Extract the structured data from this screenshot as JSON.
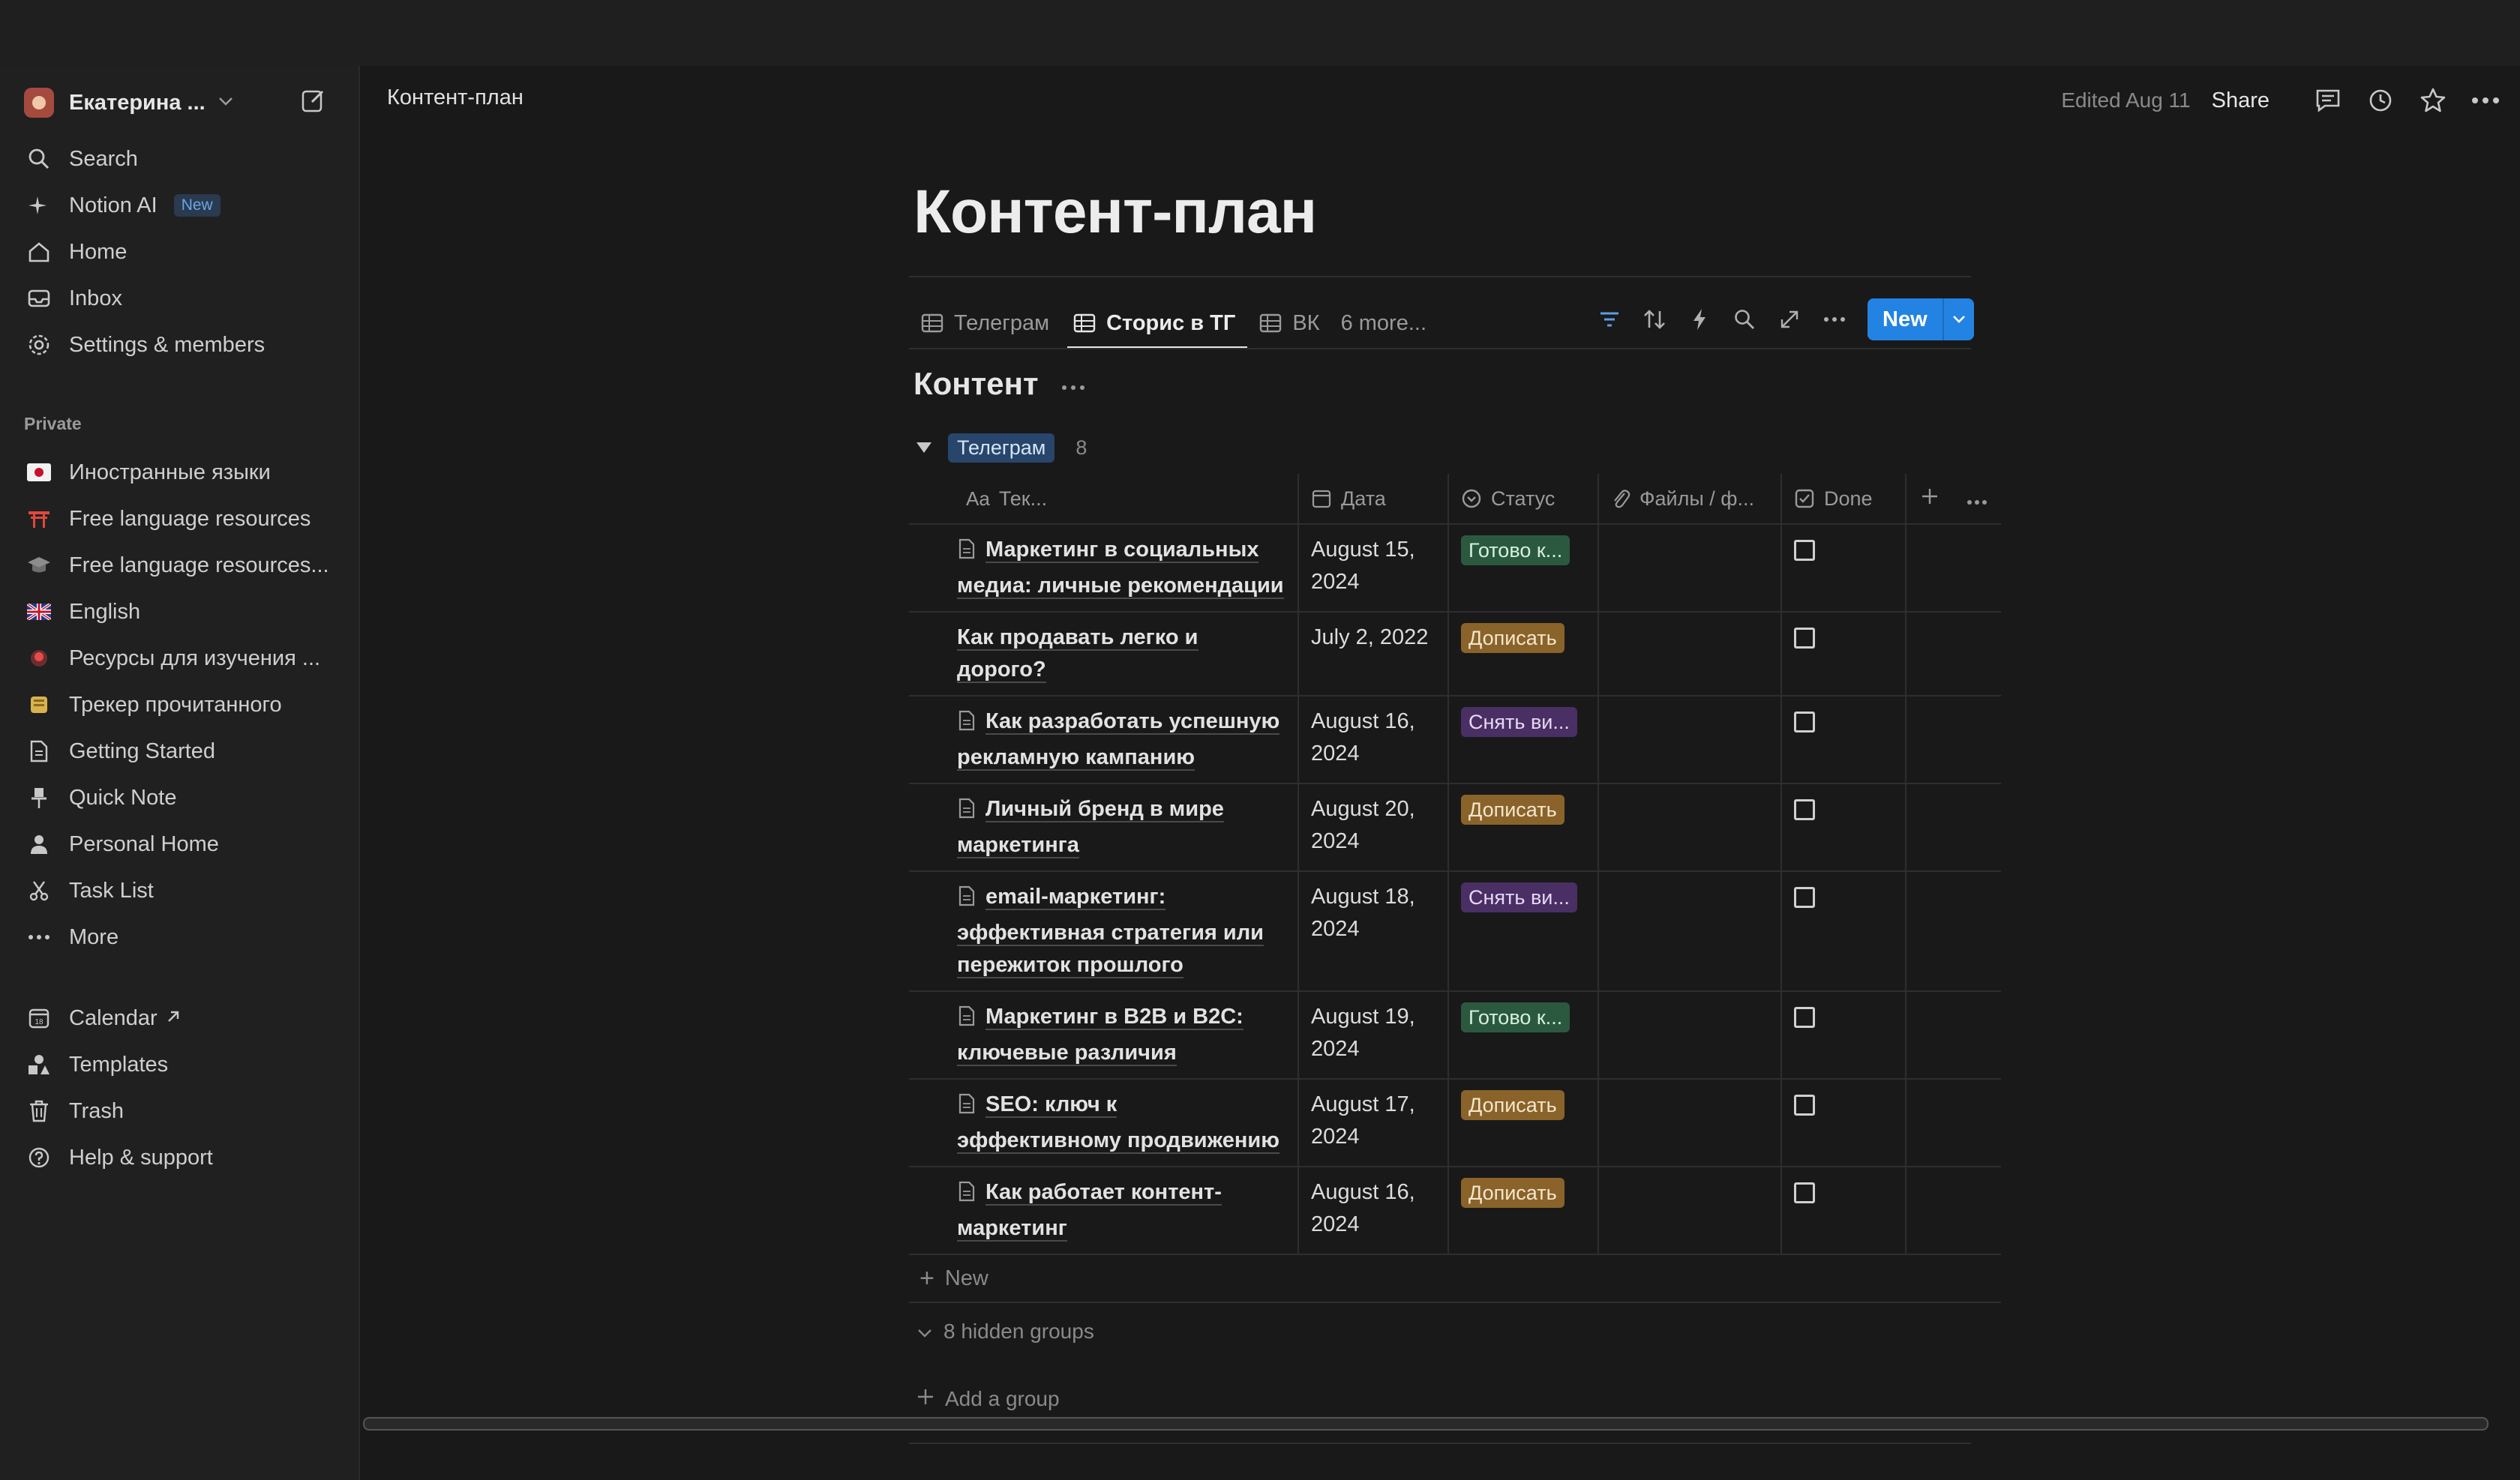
{
  "workspace": {
    "name": "Екатерина ..."
  },
  "sidebar": {
    "top_items": [
      {
        "label": "Search",
        "icon": "search-icon"
      },
      {
        "label": "Notion AI",
        "icon": "sparkle-icon",
        "badge": "New"
      },
      {
        "label": "Home",
        "icon": "home-icon"
      },
      {
        "label": "Inbox",
        "icon": "inbox-icon"
      },
      {
        "label": "Settings & members",
        "icon": "gear-icon"
      }
    ],
    "section_label": "Private",
    "private_items": [
      {
        "label": "Иностранные языки",
        "icon": "japan-flag-icon"
      },
      {
        "label": "Free language resources",
        "icon": "torii-gate-icon"
      },
      {
        "label": "Free language resources...",
        "icon": "graduation-cap-icon"
      },
      {
        "label": "English",
        "icon": "uk-flag-icon"
      },
      {
        "label": "Ресурсы для изучения ...",
        "icon": "red-badge-icon"
      },
      {
        "label": "Трекер прочитанного",
        "icon": "scroll-icon"
      },
      {
        "label": "Getting Started",
        "icon": "page-icon"
      },
      {
        "label": "Quick Note",
        "icon": "pin-icon"
      },
      {
        "label": "Personal Home",
        "icon": "person-icon"
      },
      {
        "label": "Task List",
        "icon": "scissors-icon"
      },
      {
        "label": "More",
        "icon": "more-dots-icon"
      }
    ],
    "bottom_items": [
      {
        "label": "Calendar",
        "icon": "calendar-icon"
      },
      {
        "label": "Templates",
        "icon": "templates-icon"
      },
      {
        "label": "Trash",
        "icon": "trash-icon"
      },
      {
        "label": "Help & support",
        "icon": "help-icon"
      }
    ]
  },
  "header": {
    "breadcrumb": "Контент-план",
    "edited": "Edited Aug 11",
    "share": "Share"
  },
  "page": {
    "title": "Контент-план",
    "views": [
      {
        "label": "Телеграм",
        "active": false
      },
      {
        "label": "Сторис в ТГ",
        "active": true
      },
      {
        "label": "ВК",
        "active": false
      }
    ],
    "views_more": "6 more...",
    "new_button": "New",
    "db_title": "Контент",
    "group": {
      "label": "Телеграм",
      "count": "8"
    },
    "columns": {
      "name": "Тек...",
      "name_prefix": "Aa",
      "date": "Дата",
      "status": "Статус",
      "files": "Файлы / ф...",
      "done": "Done"
    },
    "rows": [
      {
        "name": "Маркетинг в социальных медиа: личные рекомендации",
        "has_doc_icon": true,
        "date": "August 15, 2024",
        "status": "Готово к...",
        "status_color": "#2b593f"
      },
      {
        "name": "Как продавать легко и дорого?",
        "has_doc_icon": false,
        "date": "July 2, 2022",
        "status": "Дописать",
        "status_color": "#89632a"
      },
      {
        "name": "Как разработать успешную рекламную кампанию",
        "has_doc_icon": true,
        "date": "August 16, 2024",
        "status": "Снять ви...",
        "status_color": "#492f64"
      },
      {
        "name": "Личный бренд в мире маркетинга",
        "has_doc_icon": true,
        "date": "August 20, 2024",
        "status": "Дописать",
        "status_color": "#89632a"
      },
      {
        "name": "email-маркетинг: эффективная стратегия или пережиток прошлого",
        "has_doc_icon": true,
        "date": "August 18, 2024",
        "status": "Снять ви...",
        "status_color": "#492f64"
      },
      {
        "name": "Маркетинг в B2B и B2C: ключевые различия",
        "has_doc_icon": true,
        "date": "August 19, 2024",
        "status": "Готово к...",
        "status_color": "#2b593f"
      },
      {
        "name": "SEO: ключ к эффективному продвижению",
        "has_doc_icon": true,
        "date": "August 17, 2024",
        "status": "Дописать",
        "status_color": "#89632a"
      },
      {
        "name": "Как работает контент-маркетинг",
        "has_doc_icon": true,
        "date": "August 16, 2024",
        "status": "Дописать",
        "status_color": "#89632a"
      }
    ],
    "add_row": "New",
    "hidden_groups": "8 hidden groups",
    "add_group": "Add a group"
  }
}
